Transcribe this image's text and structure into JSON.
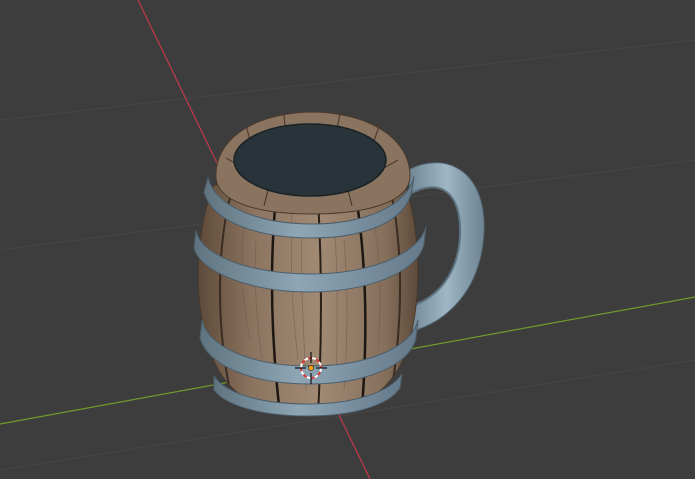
{
  "viewport": {
    "background": "#3d3d3d",
    "grid_color": "#474747",
    "x_axis_color": "#c23a48",
    "y_axis_color": "#6e9b2c"
  },
  "object": {
    "type": "barrel-mug",
    "wood_color": "#8c7560",
    "wood_dark": "#5e4a3a",
    "band_color": "#7f98a8",
    "interior_color": "#28343a"
  },
  "cursor": {
    "icon": "3d-cursor-icon",
    "ring_colors": [
      "#d83a3a",
      "#ffffff"
    ]
  },
  "origin": {
    "icon": "object-origin-icon",
    "color": "#f4a000"
  }
}
